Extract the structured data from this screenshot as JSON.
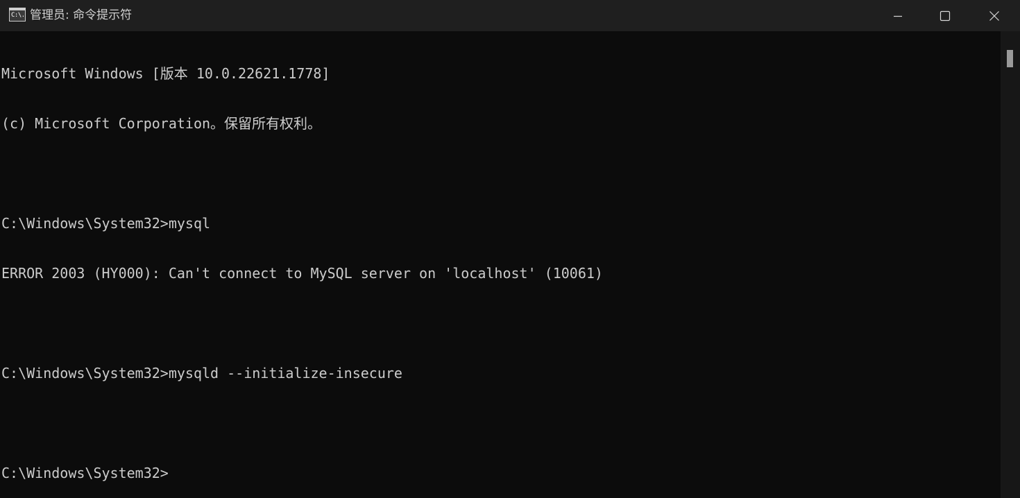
{
  "window": {
    "title": "管理员: 命令提示符",
    "app_icon_glyph": "C:\\."
  },
  "icons": {
    "app": "command-prompt-icon",
    "minimize": "minimize-icon",
    "maximize": "maximize-icon",
    "close": "close-icon"
  },
  "terminal": {
    "lines": [
      "Microsoft Windows [版本 10.0.22621.1778]",
      "(c) Microsoft Corporation。保留所有权利。",
      "",
      "C:\\Windows\\System32>mysql",
      "ERROR 2003 (HY000): Can't connect to MySQL server on 'localhost' (10061)",
      "",
      "C:\\Windows\\System32>mysqld --initialize-insecure",
      "",
      "C:\\Windows\\System32>"
    ]
  },
  "colors": {
    "background": "#0c0c0c",
    "titlebar": "#1f1f1f",
    "text": "#cccccc",
    "scroll_thumb": "#9a9a9a"
  }
}
